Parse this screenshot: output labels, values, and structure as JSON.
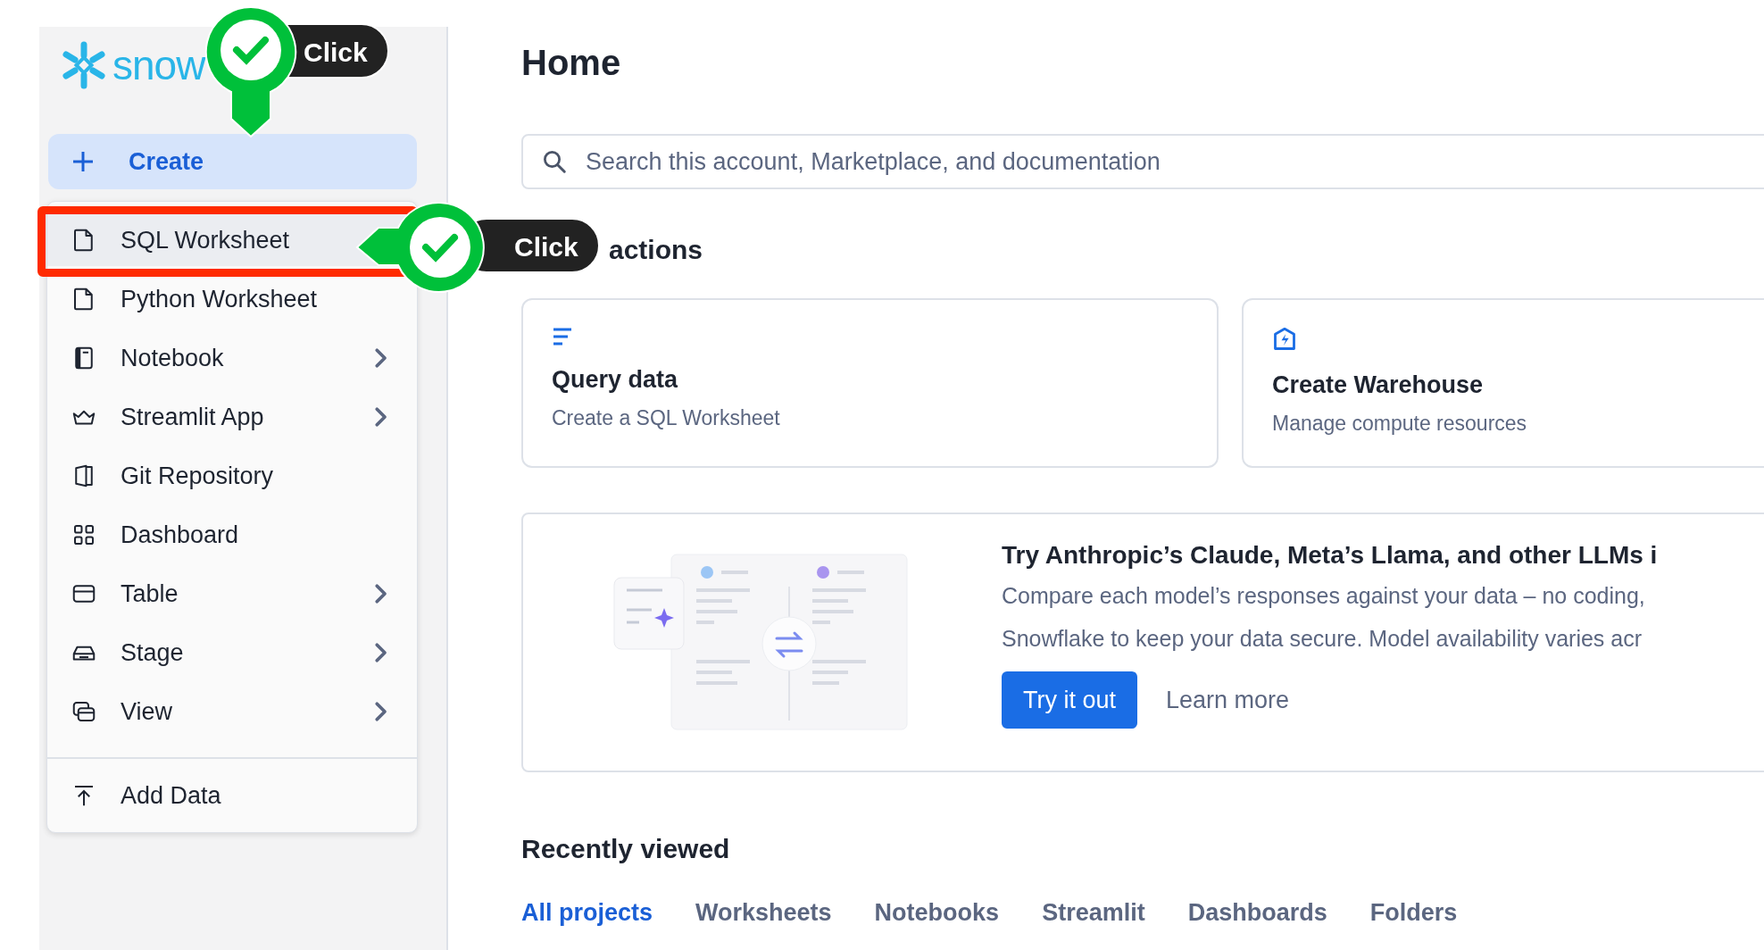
{
  "sidebar": {
    "logo": "snow",
    "create_button": "Create"
  },
  "create_menu": {
    "items": [
      {
        "label": "SQL Worksheet",
        "selected": true,
        "has_submenu": false
      },
      {
        "label": "Python Worksheet",
        "selected": false,
        "has_submenu": false
      },
      {
        "label": "Notebook",
        "selected": false,
        "has_submenu": true
      },
      {
        "label": "Streamlit App",
        "selected": false,
        "has_submenu": true
      },
      {
        "label": "Git Repository",
        "selected": false,
        "has_submenu": false
      },
      {
        "label": "Dashboard",
        "selected": false,
        "has_submenu": false
      },
      {
        "label": "Table",
        "selected": false,
        "has_submenu": true
      },
      {
        "label": "Stage",
        "selected": false,
        "has_submenu": true
      },
      {
        "label": "View",
        "selected": false,
        "has_submenu": true
      }
    ],
    "footer_item": "Add Data"
  },
  "main": {
    "title": "Home",
    "search": {
      "placeholder": "Search this account, Marketplace, and documentation"
    },
    "quick_actions": {
      "title": "actions",
      "cards": [
        {
          "kind": "query",
          "title": "Query data",
          "subtitle": "Create a SQL Worksheet"
        },
        {
          "kind": "warehouse",
          "title": "Create Warehouse",
          "subtitle": "Manage compute resources"
        }
      ]
    },
    "banner": {
      "title": "Try Anthropic’s Claude, Meta’s Llama, and other LLMs i",
      "lines": [
        "Compare each model’s responses against your data – no coding,",
        "Snowflake to keep your data secure. Model availability varies acr"
      ],
      "primary_button": "Try it out",
      "link": "Learn more"
    },
    "recently_viewed": {
      "title": "Recently viewed",
      "tabs": [
        {
          "label": "All projects",
          "selected": true
        },
        {
          "label": "Worksheets",
          "selected": false
        },
        {
          "label": "Notebooks",
          "selected": false
        },
        {
          "label": "Streamlit",
          "selected": false
        },
        {
          "label": "Dashboards",
          "selected": false
        },
        {
          "label": "Folders",
          "selected": false
        }
      ]
    }
  },
  "annotations": [
    {
      "label": "Click"
    },
    {
      "label": "Click"
    }
  ]
}
